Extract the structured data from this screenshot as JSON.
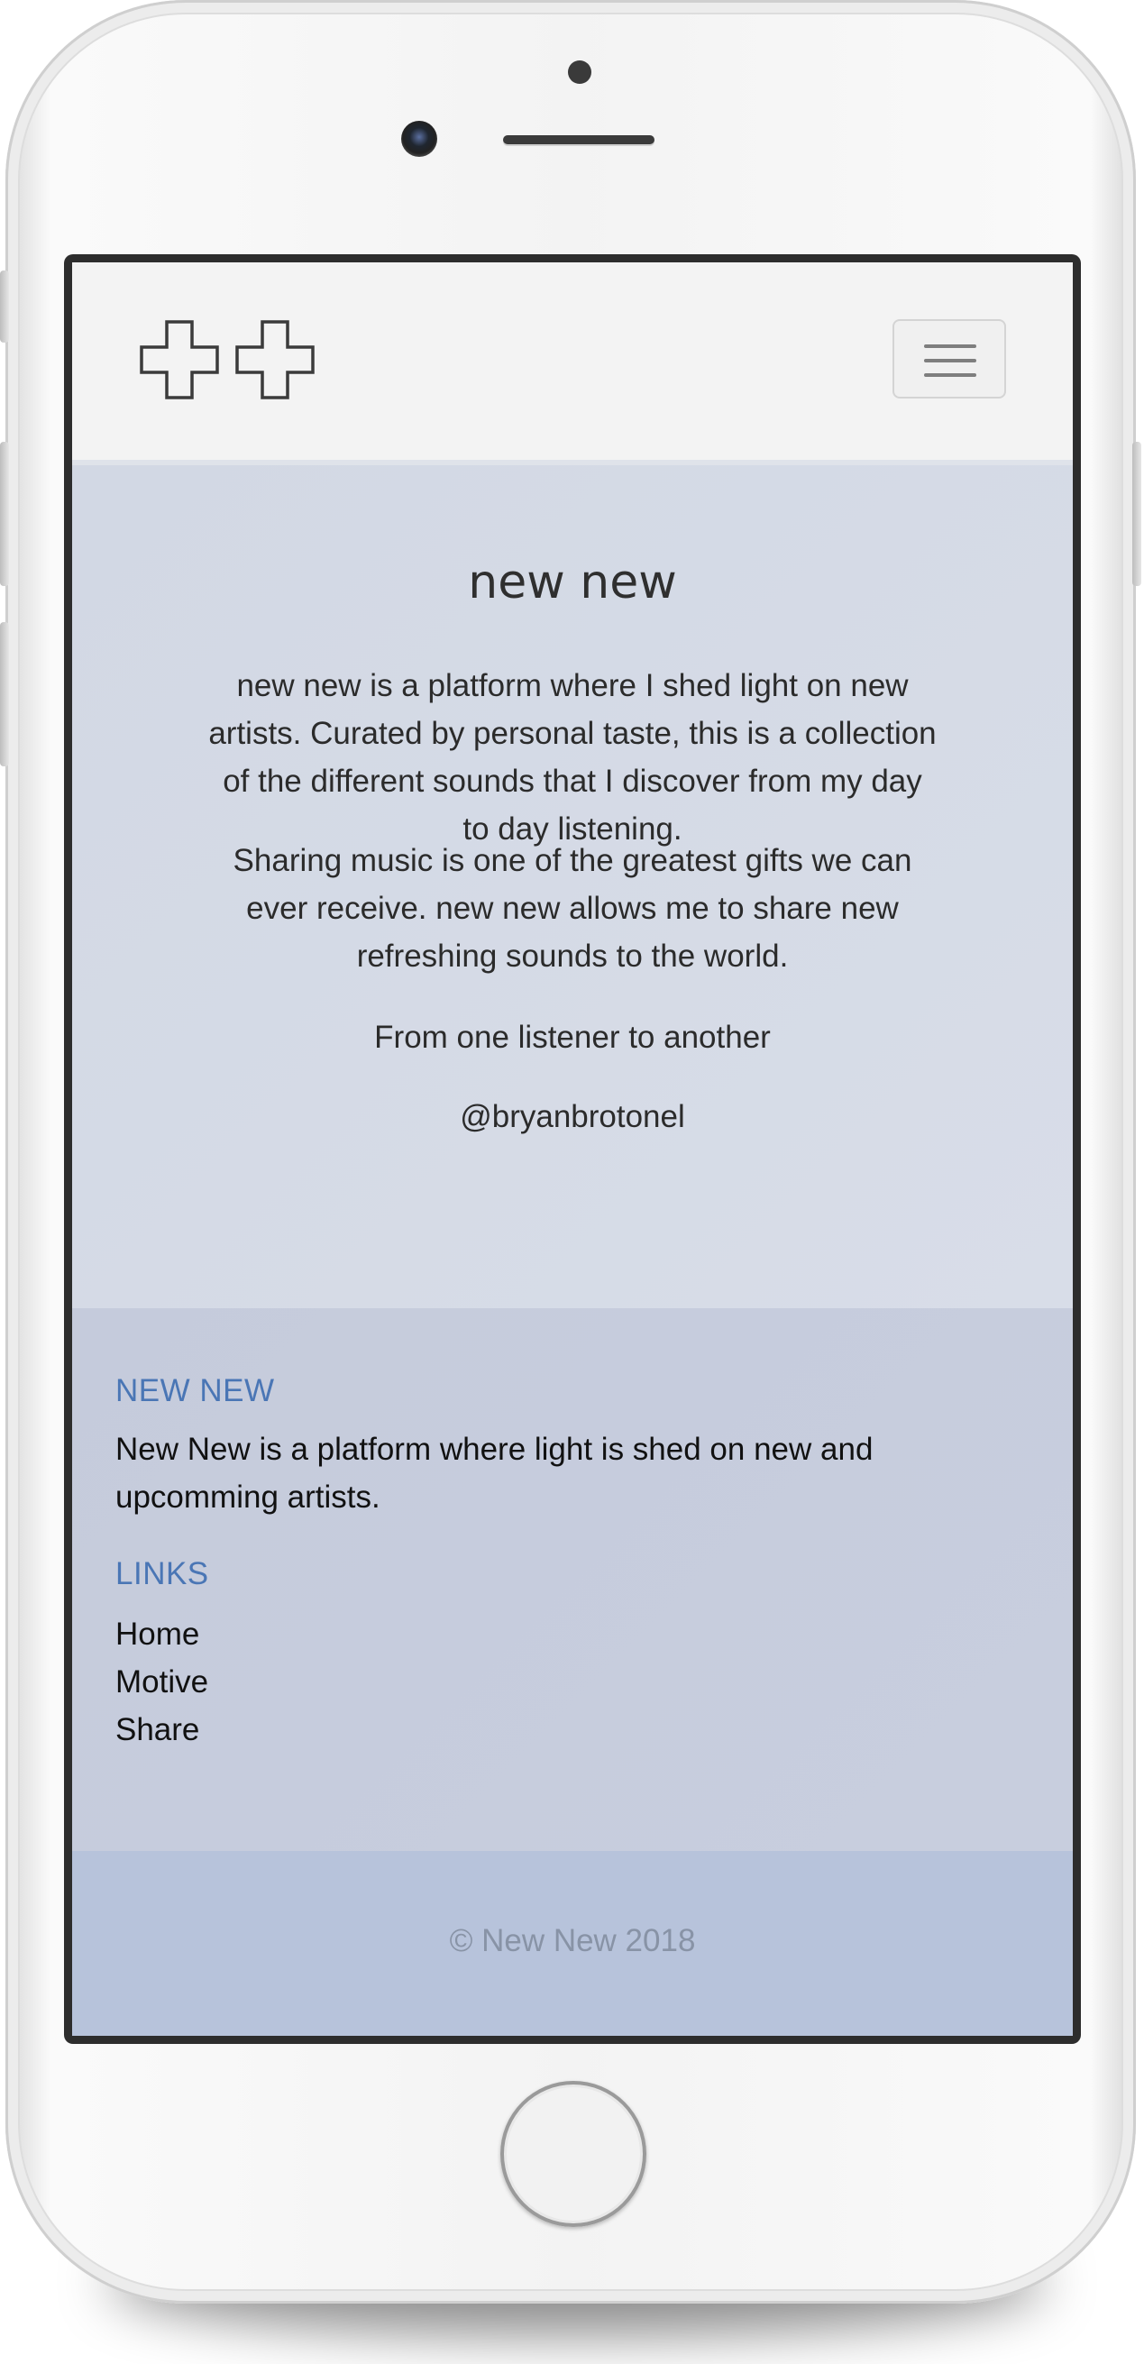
{
  "navbar": {
    "logo_icon": "double-plus-logo",
    "menu_icon": "hamburger-icon"
  },
  "hero": {
    "title": "new new",
    "paragraph_1": "new new is a platform where I shed light on new artists. Curated by personal taste, this is a collection of the different sounds that I discover from my day to day listening.",
    "paragraph_2": "Sharing music is one of the greatest gifts we can ever receive. new new allows me to share new refreshing sounds to the world.",
    "tagline": "From one listener to another",
    "handle": "@bryanbrotonel"
  },
  "footer": {
    "about_heading": "NEW NEW",
    "about_text": "New New is a platform where light is shed on new and upcomming artists.",
    "links_heading": "LINKS",
    "links": [
      "Home",
      "Motive",
      "Share"
    ],
    "heading_color": "#4a76b5"
  },
  "copyright": "© New New 2018"
}
